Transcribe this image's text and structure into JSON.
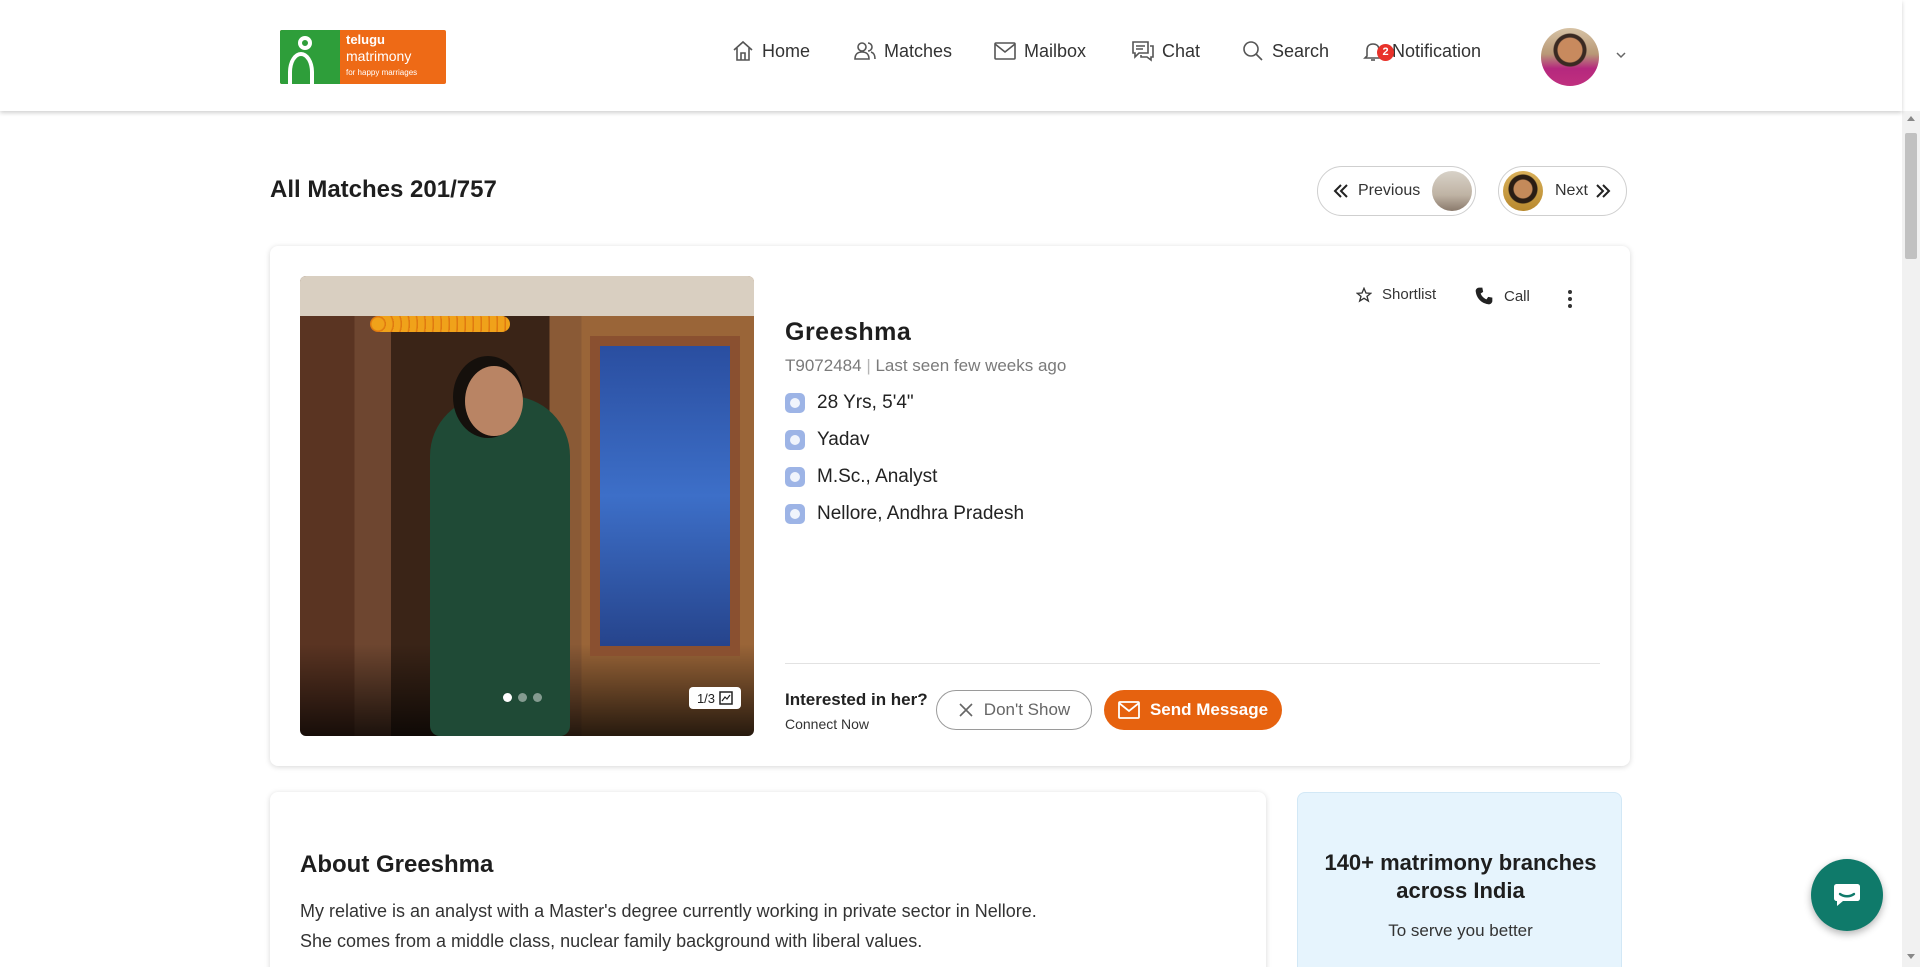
{
  "logo": {
    "line1": "telugu",
    "line2": "matrimony",
    "line3": "for happy marriages"
  },
  "nav": {
    "home": "Home",
    "matches": "Matches",
    "mailbox": "Mailbox",
    "chat": "Chat",
    "search": "Search",
    "notification": "Notification",
    "notification_count": "2"
  },
  "page": {
    "title": "All Matches 201/757",
    "previous_label": "Previous",
    "next_label": "Next"
  },
  "profile": {
    "name": "Greeshma",
    "id": "T9072484",
    "last_seen": "Last seen few weeks ago",
    "age_height": "28 Yrs, 5'4\"",
    "community": "Yadav",
    "education_job": "M.Sc., Analyst",
    "location": "Nellore, Andhra Pradesh",
    "photo_counter": "1/3",
    "photo_active_index": 0,
    "photo_total": 3,
    "shortlist_label": "Shortlist",
    "call_label": "Call",
    "interest_question": "Interested in her?",
    "interest_sub": "Connect Now",
    "dont_show_label": "Don't Show",
    "send_message_label": "Send Message"
  },
  "about": {
    "heading": "About Greeshma",
    "line1": "My relative is an analyst with a Master's degree currently working in private sector in Nellore.",
    "line2": "She comes from a middle class, nuclear family background with liberal values."
  },
  "promo": {
    "title": "140+ matrimony branches across India",
    "subtitle": "To serve you better"
  },
  "colors": {
    "brand_orange": "#e6620f",
    "brand_green": "#2e9e3a",
    "badge_red": "#e8322a",
    "chat_fab": "#0f7a6a",
    "promo_bg": "#e6f4fd"
  },
  "icons": {
    "home": "home-icon",
    "matches": "users-icon",
    "mailbox": "mail-icon",
    "chat": "chat-icon",
    "search": "search-icon",
    "notification": "bell-icon",
    "shortlist": "star-icon",
    "call": "phone-icon",
    "more": "kebab-icon",
    "dont_show": "close-icon",
    "send_message": "mail-icon",
    "chat_fab": "chat-bubble-icon"
  }
}
